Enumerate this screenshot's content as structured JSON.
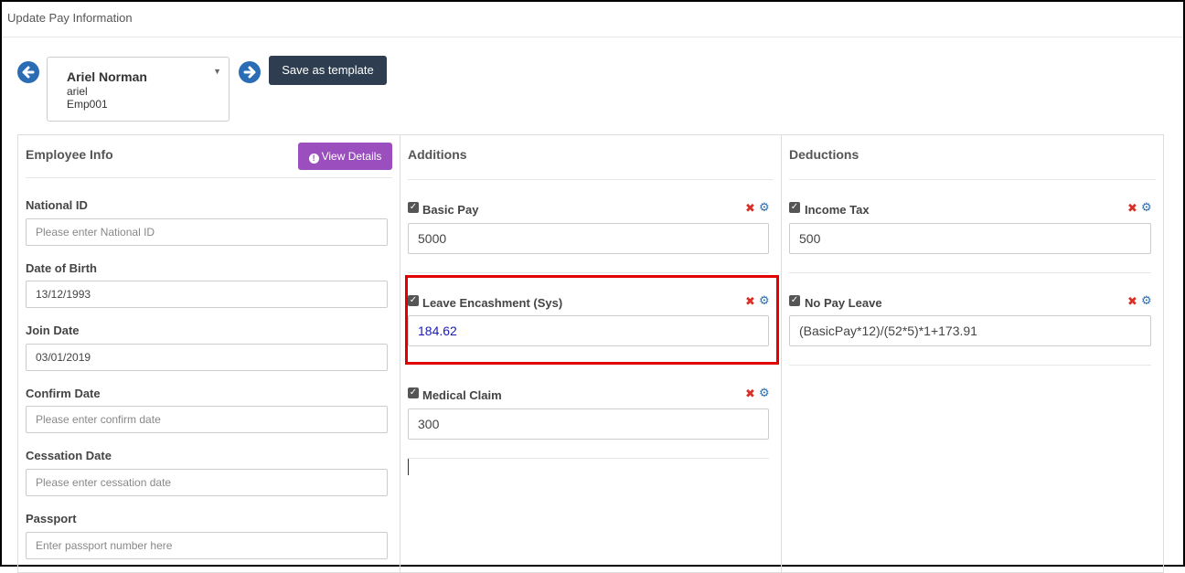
{
  "page": {
    "title": "Update Pay Information"
  },
  "employee": {
    "name": "Ariel Norman",
    "username": "ariel",
    "code": "Emp001"
  },
  "toolbar": {
    "save_template_label": "Save as template"
  },
  "employee_info": {
    "heading": "Employee Info",
    "view_details_label": "View Details",
    "fields": [
      {
        "label": "National ID",
        "value": "",
        "placeholder": "Please enter National ID"
      },
      {
        "label": "Date of Birth",
        "value": "13/12/1993",
        "placeholder": ""
      },
      {
        "label": "Join Date",
        "value": "03/01/2019",
        "placeholder": ""
      },
      {
        "label": "Confirm Date",
        "value": "",
        "placeholder": "Please enter confirm date"
      },
      {
        "label": "Cessation Date",
        "value": "",
        "placeholder": "Please enter cessation date"
      },
      {
        "label": "Passport",
        "value": "",
        "placeholder": "Enter passport number here"
      }
    ]
  },
  "additions": {
    "heading": "Additions",
    "items": [
      {
        "label": "Basic Pay",
        "value": "5000",
        "checked": true
      },
      {
        "label": "Leave Encashment (Sys)",
        "value": "184.62",
        "checked": true
      },
      {
        "label": "Medical Claim",
        "value": "300",
        "checked": true
      }
    ]
  },
  "deductions": {
    "heading": "Deductions",
    "items": [
      {
        "label": "Income Tax",
        "value": "500",
        "checked": true
      },
      {
        "label": "No Pay Leave",
        "value": "(BasicPay*12)/(52*5)*1+173.91",
        "checked": true
      }
    ]
  },
  "colors": {
    "primary": "#2e3e50",
    "accent_purple": "#9b4fbf",
    "link_blue": "#2a6db5",
    "danger": "#d93025",
    "highlight": "#e00000"
  }
}
